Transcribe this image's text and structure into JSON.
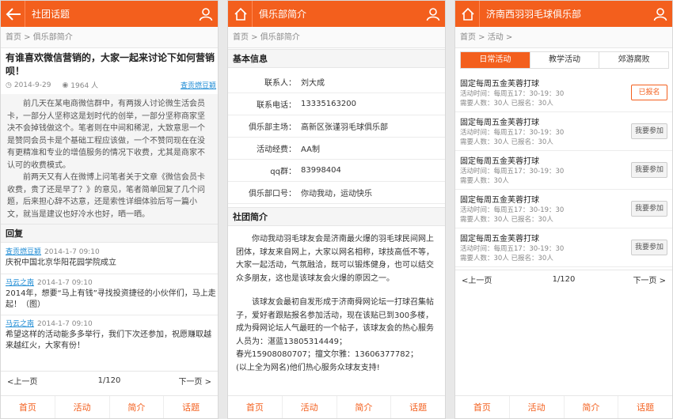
{
  "screen1": {
    "header_title": "社团话题",
    "breadcrumb": "首页 >  俱乐部简介",
    "article_title": "有谁喜欢微信营销的，大家一起来讨论下如何营销呗！",
    "date": "2014-9-29",
    "views": "1964 人",
    "author": "查贡燃豆颖",
    "body_p1": "前几天在某电商微信群中，有两拨人讨论微生活会员卡，一部分人坚称这是划时代的创举，一部分坚称商家坚决不会掉钱做这个。笔者则在中间和稀泥，大致意思一个是赞同会员卡是个基础工程应该做，一个不赞同现在在没有更精准和专业的增值服务的情况下收费，尤其是商家不认可的收费模式。",
    "body_p2": "前两天又有人在微博上问笔者关于文章《微信会员卡收费，贵了还是早了？》的意见，笔者简单回复了几个问题，后来担心辞不达意，还是索性详细体验后写一篇小文，就当是建议也好冷水也好，晒一晒。",
    "reply_heading": "回复",
    "replies": [
      {
        "user": "查贡燃豆颖",
        "time": "2014-1-7  09:10",
        "text": "庆祝中国北京华阳花园学院成立"
      },
      {
        "user": "马云之南",
        "time": "2014-1-7  09:10",
        "text": "2014年，想要“马上有钱”寻找投资捷径的小伙伴们，马上走起！（图）"
      },
      {
        "user": "马云之南",
        "time": "2014-1-7  09:10",
        "text": "希望这样的活动能多多举行，我们下次还参加，祝愿赚取越来越红火，大家有份！"
      }
    ],
    "pager": {
      "prev": "<上一页",
      "count": "1/120",
      "next": "下一页 >"
    }
  },
  "screen2": {
    "header_title": "俱乐部简介",
    "breadcrumb": "首页 >  俱乐部简介",
    "basic_heading": "基本信息",
    "info": [
      {
        "k": "联系人：",
        "v": "刘大成"
      },
      {
        "k": "联系电话：",
        "v": "13335163200"
      },
      {
        "k": "俱乐部主场：",
        "v": "高新区张谨羽毛球俱乐部"
      },
      {
        "k": "活动经费：",
        "v": "AA制"
      },
      {
        "k": "qq群：",
        "v": "83998404"
      },
      {
        "k": "俱乐部口号：",
        "v": "你动我动，运动快乐"
      }
    ],
    "intro_heading": "社团简介",
    "intro_p1": "你动我动羽毛球友会是济南最火爆的羽毛球民间网上团体，球友来自网上，大家以网名相称，球技高低不等，大家一起活动，气氛融洽，既可以锻炼健身，也可以结交众多朋友，这也是该球友会火爆的原因之一。",
    "intro_p2": "该球友会最初自发形成于济南舜网论坛一打球召集帖子，爱好者跟贴报名参加活动，现在该贴已到300多楼，成为舜网论坛人气最旺的一个帖子，该球友会的热心服务人员为：湛蓝13805314449；",
    "intro_p3": "春光15908080707；擅文尔雅：13606377782；",
    "intro_p4": "(以上全为网名)他们热心服务众球友支持!"
  },
  "screen3": {
    "header_title": "济南西羽羽毛球俱乐部",
    "breadcrumb": "首页 >  活动 >",
    "tabs": [
      "日常活动",
      "教学活动",
      "郊游腐败"
    ],
    "activities": [
      {
        "name": "固定每周五金芙蓉打球",
        "time": "活动时间：每周五17：30-19：30",
        "people": "需要人数：30人   已报名：30人",
        "btn": "已报名",
        "done": true
      },
      {
        "name": "固定每周五金芙蓉打球",
        "time": "活动时间：每周五17：30-19：30",
        "people": "需要人数：30人   已报名：30人",
        "btn": "我要参加",
        "done": false
      },
      {
        "name": "固定每周五金芙蓉打球",
        "time": "活动时间：每周五17：30-19：30",
        "people": "需要人数：30人",
        "btn": "我要参加",
        "done": false
      },
      {
        "name": "固定每周五金芙蓉打球",
        "time": "活动时间：每周五17：30-19：30",
        "people": "需要人数：30人   已报名：30人",
        "btn": "我要参加",
        "done": false
      },
      {
        "name": "固定每周五金芙蓉打球",
        "time": "活动时间：每周五17：30-19：30",
        "people": "需要人数：30人   已报名：30人",
        "btn": "我要参加",
        "done": false
      }
    ],
    "pager": {
      "prev": "<上一页",
      "count": "1/120",
      "next": "下一页 >"
    }
  },
  "tabbar": [
    "首页",
    "活动",
    "简介",
    "话题"
  ],
  "colors": {
    "accent": "#f35f1d",
    "link": "#1d8bd4"
  }
}
